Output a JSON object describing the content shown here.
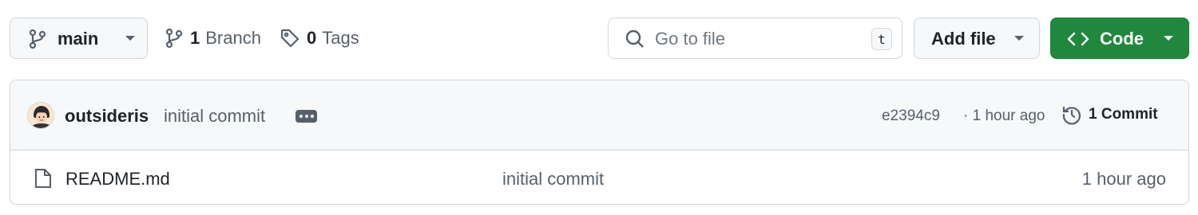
{
  "toolbar": {
    "branch": {
      "name": "main"
    },
    "branches": {
      "count": "1",
      "label": "Branch"
    },
    "tags": {
      "count": "0",
      "label": "Tags"
    },
    "search": {
      "placeholder": "Go to file",
      "shortcut": "t"
    },
    "add_file_label": "Add file",
    "code_label": "Code"
  },
  "latest_commit": {
    "author": "outsideris",
    "message": "initial commit",
    "hash": "e2394c9",
    "time": "1 hour ago",
    "count_label": "1 Commit"
  },
  "files": [
    {
      "name": "README.md",
      "message": "initial commit",
      "time": "1 hour ago",
      "icon": "file-icon"
    }
  ],
  "colors": {
    "code_button": "#1f883d",
    "border": "#d0d7de",
    "header_bg": "#f6f8fa",
    "muted_text": "#57606a"
  }
}
